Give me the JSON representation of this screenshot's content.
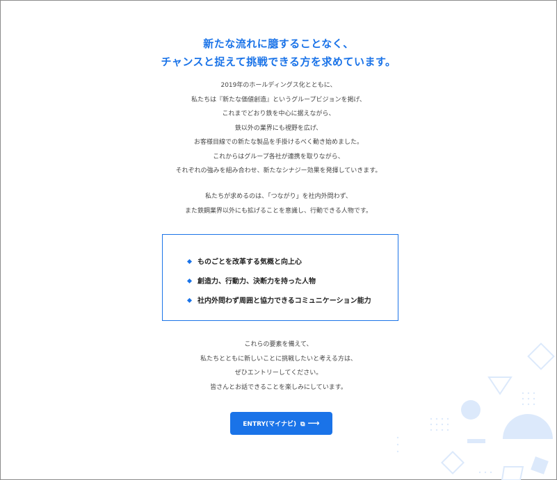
{
  "headline": {
    "line1": "新たな流れに臆することなく、",
    "line2": "チャンスと捉えて挑戦できる方を求めています。"
  },
  "intro_lines": [
    "2019年のホールディングス化とともに、",
    "私たちは『新たな価値創造』というグループビジョンを掲げ、",
    "これまでどおり鉄を中心に据えながら、",
    "鉄以外の業界にも視野を広げ、",
    "お客様目線での新たな製品を手掛けるべく動き始めました。",
    "これからはグループ各社が連携を取りながら、",
    "それぞれの強みを組み合わせ、新たなシナジー効果を発揮していきます。"
  ],
  "seek_lines": [
    "私たちが求めるのは、「つながり」を社内外問わず、",
    "また鉄鋼業界以外にも拡げることを意識し、行動できる人物です。"
  ],
  "qualities": [
    "ものごとを改革する気概と向上心",
    "創造力、行動力、決断力を持った人物",
    "社内外問わず周囲と協力できるコミュニケーション能力"
  ],
  "closing_lines": [
    "これらの要素を備えて、",
    "私たちとともに新しいことに挑戦したいと考える方は、",
    "ぜひエントリーしてください。",
    "皆さんとお話できることを楽しみにしています。"
  ],
  "entry_button": {
    "label": "ENTRY(マイナビ)"
  },
  "colors": {
    "accent": "#1a73e8",
    "deco": "#dce9fb"
  }
}
